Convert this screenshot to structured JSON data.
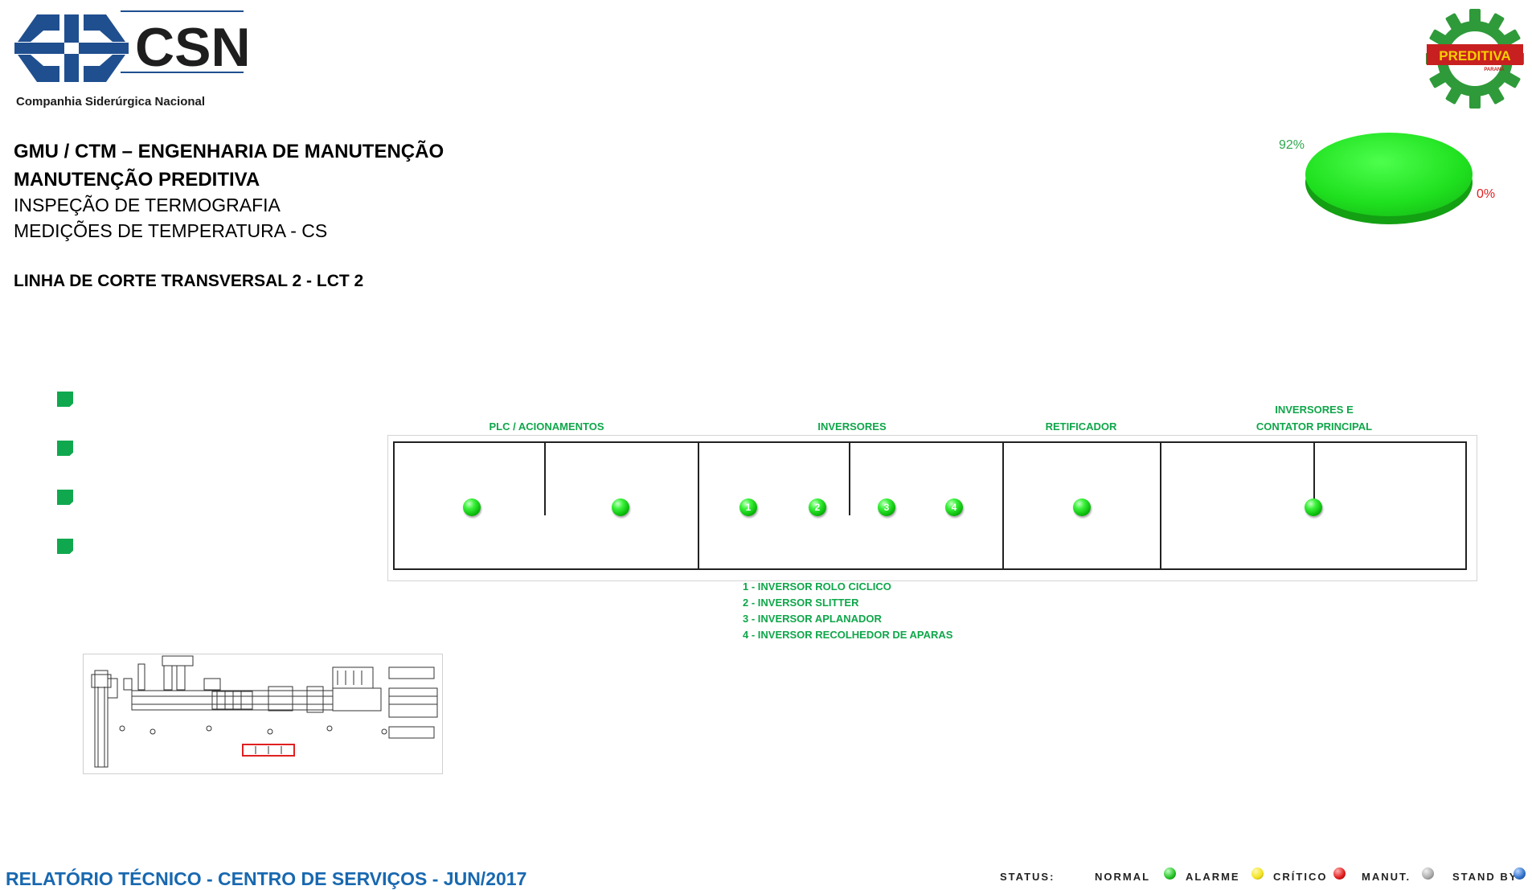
{
  "company": {
    "logo_text": "CSN",
    "name": "Companhia Siderúrgica Nacional"
  },
  "brand_logo": {
    "text": "PREDITIVA",
    "subtext": "PARANÁ"
  },
  "header": {
    "line1": "GMU / CTM – ENGENHARIA DE MANUTENÇÃO",
    "line2": "MANUTENÇÃO PREDITIVA",
    "line3": "INSPEÇÃO DE TERMOGRAFIA",
    "line4": "MEDIÇÕES DE TEMPERATURA - CS",
    "line5": "LINHA DE CORTE TRANSVERSAL 2 - LCT 2"
  },
  "pie": {
    "label_green": "92%",
    "label_red": "0%",
    "colors": {
      "green": "#1cd01c",
      "red": "#e02020"
    }
  },
  "diagram": {
    "sections": [
      {
        "label": "PLC / ACIONAMENTOS"
      },
      {
        "label": "INVERSORES"
      },
      {
        "label": "RETIFICADOR"
      },
      {
        "label_line1": "INVERSORES  E",
        "label_line2": "CONTATOR  PRINCIPAL"
      }
    ],
    "points": [
      {
        "label": "",
        "status": "normal"
      },
      {
        "label": "",
        "status": "normal"
      },
      {
        "label": "1",
        "status": "normal"
      },
      {
        "label": "2",
        "status": "normal"
      },
      {
        "label": "3",
        "status": "normal"
      },
      {
        "label": "4",
        "status": "normal"
      },
      {
        "label": "",
        "status": "normal"
      },
      {
        "label": "",
        "status": "normal"
      }
    ],
    "notes": [
      "1 - INVERSOR  ROLO CICLICO",
      "2 - INVERSOR  SLITTER",
      "3 - INVERSOR  APLANADOR",
      "4 - INVERSOR  RECOLHEDOR  DE APARAS"
    ]
  },
  "footer": {
    "title": "RELATÓRIO TÉCNICO - CENTRO DE SERVIÇOS - JUN/2017",
    "status_label": "STATUS:",
    "statuses": [
      {
        "label": "NORMAL",
        "color": "#22c022"
      },
      {
        "label": "ALARME",
        "color": "#f2e21a"
      },
      {
        "label": "CRÍTICO",
        "color": "#e01818"
      },
      {
        "label": "MANUT.",
        "color": "#a8a8a8"
      },
      {
        "label": "STAND BY",
        "color": "#2f6fc8"
      }
    ]
  }
}
